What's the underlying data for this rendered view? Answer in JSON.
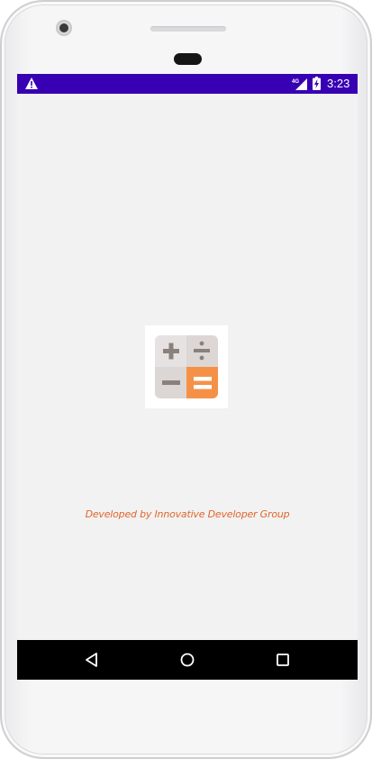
{
  "status_bar": {
    "time": "3:23",
    "network_label": "4G",
    "background_color": "#3700b3",
    "icons": [
      "warning-icon",
      "cellular-signal-icon",
      "battery-charging-icon"
    ]
  },
  "splash": {
    "logo_icon": "calculator-icon",
    "credit_text": "Developed by Innovative Developer Group",
    "credit_color": "#e0662a"
  },
  "navigation_bar": {
    "buttons": [
      "back-icon",
      "home-icon",
      "recents-icon"
    ]
  },
  "colors": {
    "logo_orange": "#f59147",
    "logo_tile": "#e6e2e1",
    "logo_symbol": "#8a817c",
    "screen_background": "#f2f2f2"
  }
}
